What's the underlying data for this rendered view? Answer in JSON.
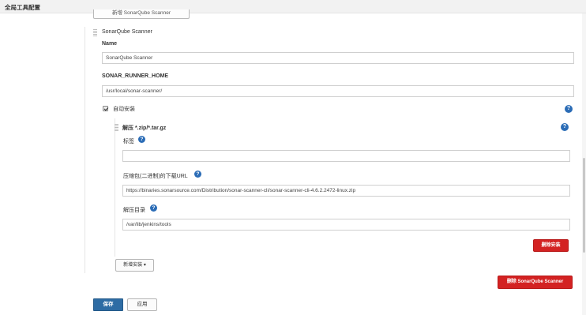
{
  "page": {
    "title": "全局工具配置"
  },
  "scanner": {
    "cut_button_label": "新增 SonarQube Scanner",
    "section_title": "SonarQube Scanner",
    "name_label": "Name",
    "name_value": "SonarQube Scanner",
    "home_label": "SONAR_RUNNER_HOME",
    "home_value": "/usr/local/sonar-scanner/",
    "auto_install_label": "自动安装",
    "auto_install_checked": true,
    "installer": {
      "title": "解压 *.zip/*.tar.gz",
      "tag_label": "标签",
      "tag_value": "",
      "url_label": "压缩包(二进制)的下载URL",
      "url_value": "https://binaries.sonarsource.com/Distribution/sonar-scanner-cli/sonar-scanner-cli-4.6.2.2472-linux.zip",
      "dir_label": "解压目录",
      "dir_value": "/var/lib/jenkins/tools",
      "delete_installer_label": "删除安装"
    },
    "add_installer_label": "新增安装 ▾",
    "delete_scanner_label": "删除 SonarQube Scanner"
  },
  "footer": {
    "save_label": "保存",
    "apply_label": "应用"
  },
  "help_glyph": "?",
  "icons": [
    "help-icon",
    "drag-handle-icon",
    "checkbox-icon"
  ],
  "colors": {
    "primary": "#2e6ca4",
    "danger": "#d32222",
    "help": "#2b6cb6"
  }
}
